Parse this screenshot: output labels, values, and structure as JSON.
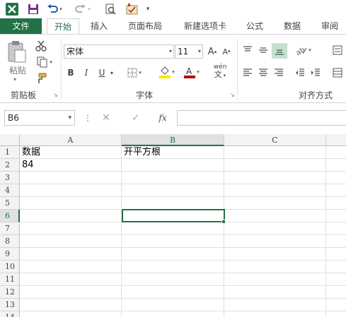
{
  "colors": {
    "accent": "#217346",
    "select_fill": "#e1e1e1",
    "grid_line": "#e0e0e0"
  },
  "qat": {
    "icons": [
      "excel-logo-icon",
      "save-icon",
      "undo-icon",
      "redo-icon",
      "print-preview-icon",
      "spell-check-icon",
      "customize-qat-icon"
    ]
  },
  "tabs": [
    "文件",
    "开始",
    "插入",
    "页面布局",
    "新建选项卡",
    "公式",
    "数据",
    "审阅"
  ],
  "ribbon": {
    "clipboard": {
      "paste_label": "粘贴",
      "group_label": "剪贴板"
    },
    "font": {
      "font_name": "宋体",
      "font_size": "11",
      "bold": "B",
      "italic": "I",
      "underline": "U",
      "phonetic": "wén",
      "group_label": "字体"
    },
    "alignment": {
      "group_label": "对齐方式"
    }
  },
  "formula_bar": {
    "name_box": "B6",
    "fx": "fx",
    "content": ""
  },
  "grid": {
    "columns": [
      "A",
      "B",
      "C"
    ],
    "rows": [
      "1",
      "2",
      "3",
      "4",
      "5",
      "6",
      "7",
      "8",
      "9",
      "10",
      "11",
      "12",
      "13",
      "14"
    ],
    "selected_cell": "B6",
    "cells": {
      "A1": "数据",
      "B1": "开平方根",
      "A2": "84"
    }
  }
}
